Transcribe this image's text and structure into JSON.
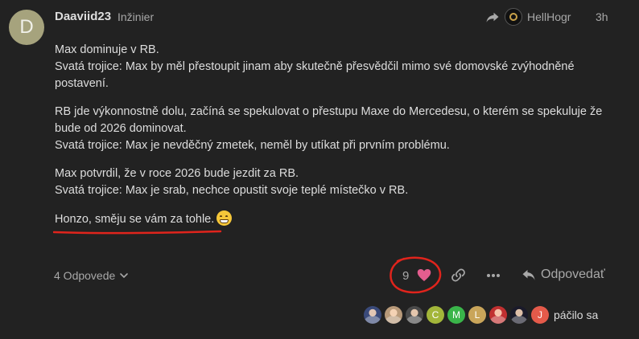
{
  "post": {
    "avatar_letter": "D",
    "avatar_color": "#a6a37d",
    "username": "Daaviid23",
    "user_title": "Inžinier",
    "reply_to_name": "HellHogr",
    "age": "3h",
    "paragraphs": [
      [
        "Max dominuje v RB.",
        "Svatá trojice: Max by měl přestoupit jinam aby skutečně přesvědčil mimo své domovské zvýhodněné postavení."
      ],
      [
        "RB jde výkonnostně dolu, začíná se spekulovat o přestupu Maxe do Mercedesu, o kterém se spekuluje že bude od 2026 dominovat.",
        "Svatá trojice: Max je nevděčný zmetek, neměl by utíkat při prvním problému."
      ],
      [
        "Max potvrdil, že v roce 2026 bude jezdit za RB.",
        "Svatá trojice: Max je srab, nechce opustit svoje teplé místečko v RB."
      ]
    ],
    "closing_line": "Honzo, směju se vám za tohle."
  },
  "actions": {
    "replies_label": "4 Odpovede",
    "like_count": "9",
    "reply_label": "Odpovedať"
  },
  "likers": {
    "avatars": [
      {
        "kind": "image",
        "color": "#3a4a7a"
      },
      {
        "kind": "image",
        "color": "#b89a7a"
      },
      {
        "kind": "image",
        "color": "#4a4a4a"
      },
      {
        "kind": "letter",
        "letter": "C",
        "color": "#a3b63a"
      },
      {
        "kind": "letter",
        "letter": "M",
        "color": "#3ab54a"
      },
      {
        "kind": "letter",
        "letter": "L",
        "color": "#c9a55a"
      },
      {
        "kind": "image",
        "color": "#c03030"
      },
      {
        "kind": "image",
        "color": "#1a1a2a"
      },
      {
        "kind": "letter",
        "letter": "J",
        "color": "#e45a4a"
      }
    ],
    "label": "páčilo sa"
  },
  "colors": {
    "background": "#222222",
    "text": "#dddddd",
    "muted": "#a8a8a8",
    "heart": "#e45d8f",
    "annotation": "#e0241c"
  }
}
